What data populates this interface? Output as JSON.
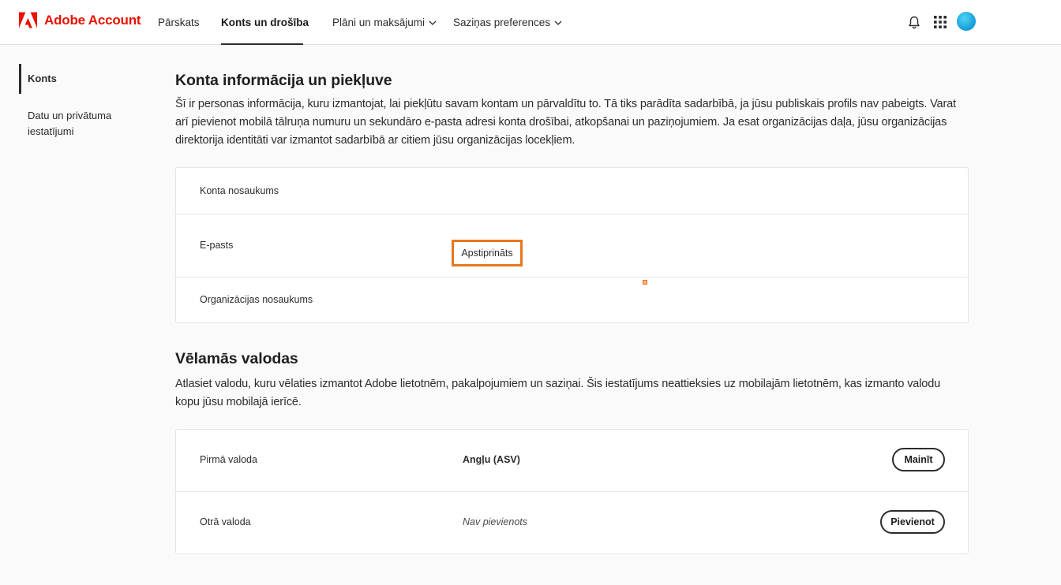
{
  "brand": {
    "name": "Adobe Account",
    "logo_color": "#eb1000"
  },
  "nav": {
    "items": [
      {
        "label": "Pārskats",
        "active": false,
        "dropdown": false
      },
      {
        "label": "Konts un drošība",
        "active": true,
        "dropdown": true
      },
      {
        "label": "Plāni un maksājumi",
        "active": false,
        "dropdown": true
      },
      {
        "label": "Saziņas preferences",
        "active": false,
        "dropdown": true
      }
    ]
  },
  "header_icons": [
    "bell-icon",
    "apps-grid-icon",
    "avatar"
  ],
  "sidebar": {
    "items": [
      {
        "label": "Konts",
        "active": true
      },
      {
        "label": "Datu un privātuma iestatījumi",
        "active": false
      }
    ]
  },
  "account_section": {
    "title": "Konta informācija un piekļuve",
    "description": "Šī ir personas informācija, kuru izmantojat, lai piekļūtu savam kontam un pārvaldītu to. Tā tiks parādīta sadarbībā, ja jūsu publiskais profils nav pabeigts. Varat arī pievienot mobilā tālruņa numuru un sekundāro e-pasta adresi konta drošībai, atkopšanai un paziņojumiem. Ja esat organizācijas daļa, jūsu organizācijas direktorija identitāti var izmantot sadarbībā ar citiem jūsu organizācijas locekļiem.",
    "rows": {
      "account_name": {
        "label": "Konta nosaukums"
      },
      "email": {
        "label": "E-pasts",
        "status": "Apstiprināts"
      },
      "org_name": {
        "label": "Organizācijas nosaukums"
      }
    }
  },
  "language_section": {
    "title": "Vēlamās valodas",
    "description": "Atlasiet valodu, kuru vēlaties izmantot Adobe lietotnēm, pakalpojumiem un saziņai. Šis iestatījums neattieksies uz mobilajām lietotnēm, kas izmanto valodu kopu jūsu mobilajā ierīcē.",
    "rows": {
      "first": {
        "label": "Pirmā valoda",
        "value": "Angļu (ASV)",
        "button": "Mainīt"
      },
      "second": {
        "label": "Otrā valoda",
        "value": "Nav pievienots",
        "button": "Pievienot"
      }
    }
  },
  "colors": {
    "highlight": "#e8771e",
    "text": "#2c2c2c"
  }
}
